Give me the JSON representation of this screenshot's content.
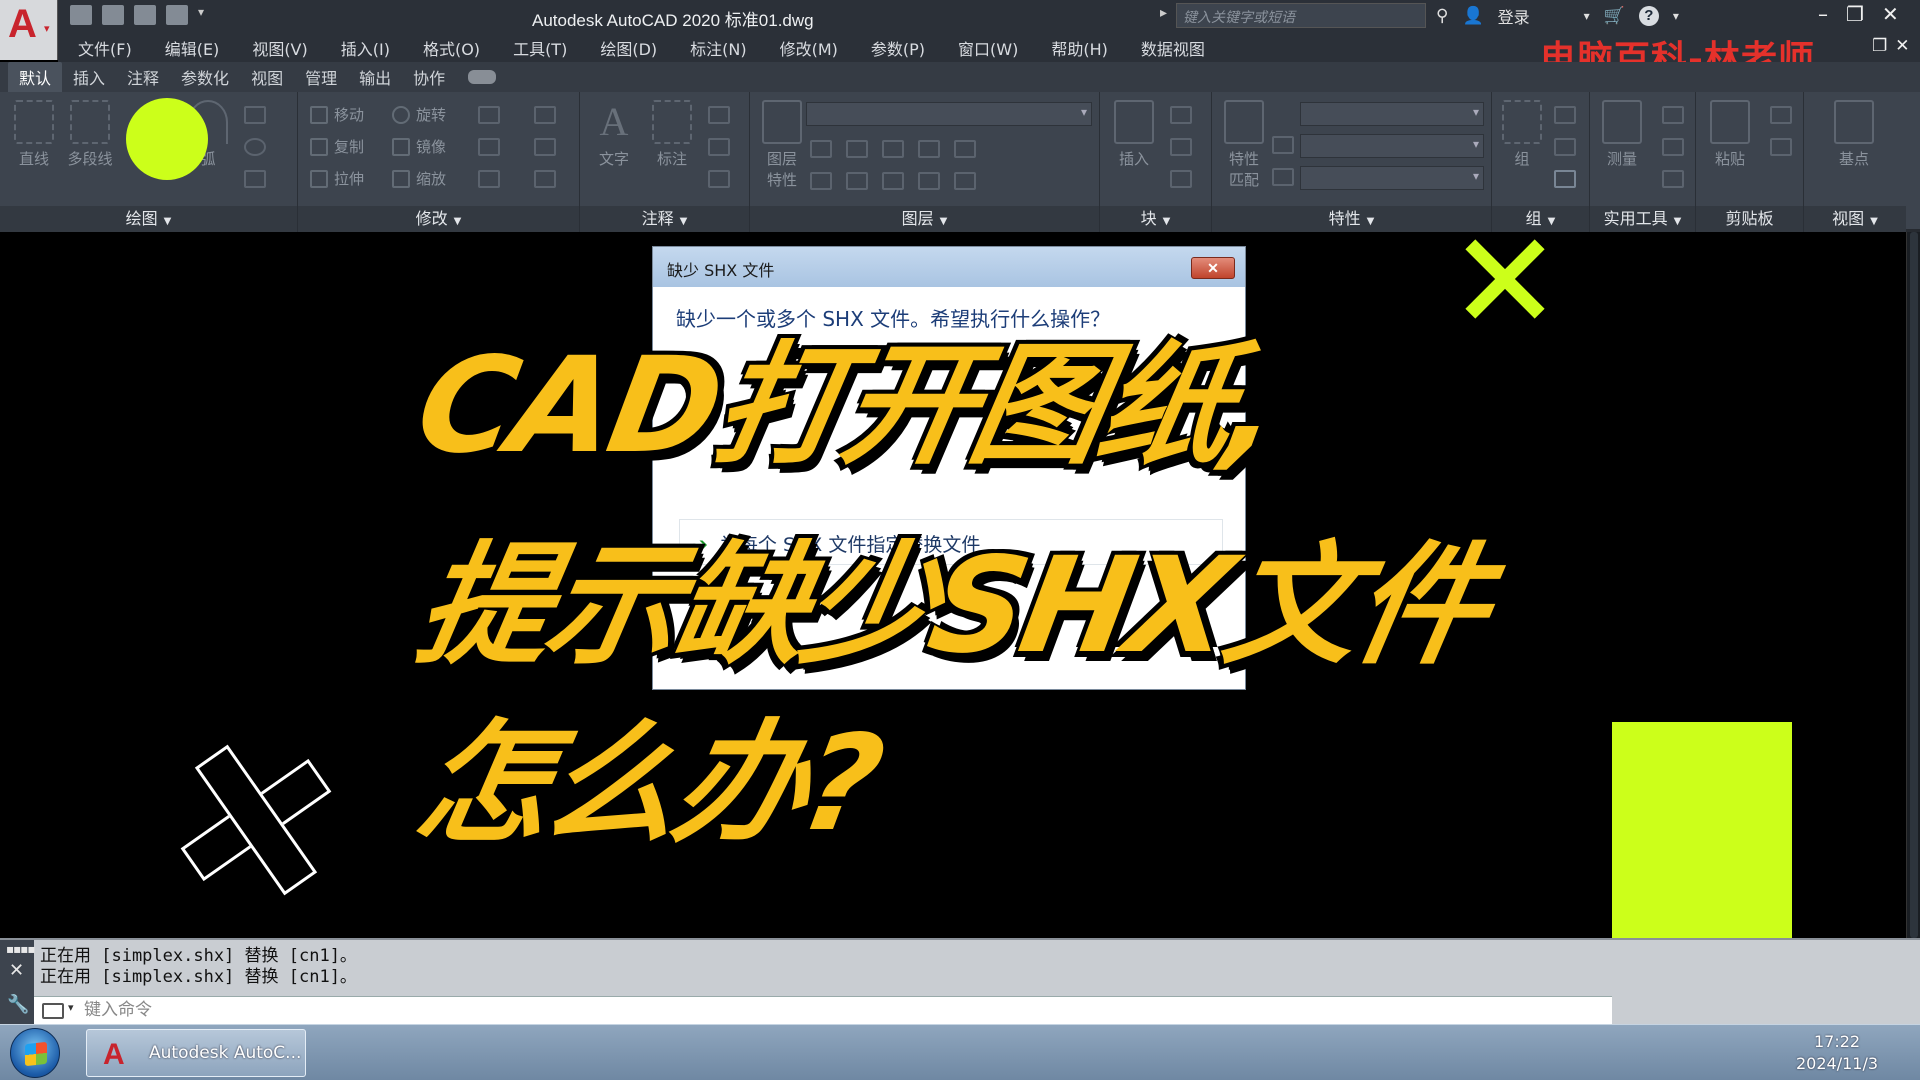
{
  "window": {
    "title": "Autodesk AutoCAD 2020    标准01.dwg",
    "search_placeholder": "键入关键字或短语",
    "login_label": "登录",
    "watermark": "电脑百科-林老师"
  },
  "menu": [
    "文件(F)",
    "编辑(E)",
    "视图(V)",
    "插入(I)",
    "格式(O)",
    "工具(T)",
    "绘图(D)",
    "标注(N)",
    "修改(M)",
    "参数(P)",
    "窗口(W)",
    "帮助(H)",
    "数据视图"
  ],
  "ribbon_tabs": [
    "默认",
    "插入",
    "注释",
    "参数化",
    "视图",
    "管理",
    "输出",
    "协作"
  ],
  "panels": {
    "draw": {
      "title": "绘图",
      "line": "直线",
      "polyline": "多段线",
      "arc": "弧"
    },
    "modify": {
      "title": "修改",
      "move": "移动",
      "rotate": "旋转",
      "copy": "复制",
      "mirror": "镜像",
      "stretch": "拉伸",
      "scale": "缩放"
    },
    "annotation": {
      "title": "注释",
      "text": "文字",
      "dimension": "标注"
    },
    "layers": {
      "title": "图层",
      "layer_props_1": "图层",
      "layer_props_2": "特性"
    },
    "block": {
      "title": "块",
      "insert": "插入"
    },
    "properties": {
      "title": "特性",
      "match_1": "特性",
      "match_2": "匹配"
    },
    "groups": {
      "title": "组",
      "group": "组"
    },
    "utilities": {
      "title": "实用工具",
      "measure": "测量"
    },
    "clipboard": {
      "title": "剪贴板",
      "paste": "粘贴"
    },
    "view": {
      "title": "视图",
      "base": "基点"
    }
  },
  "dialog": {
    "title": "缺少 SHX 文件",
    "close_label": "✕",
    "question": "缺少一个或多个 SHX 文件。希望执行什么操作？",
    "option": "为每个 SHX 文件指定替换文件"
  },
  "overlay": {
    "line1": "CAD打开图纸,",
    "line2": "提示缺少SHX文件",
    "line3": "怎么办?"
  },
  "command_line": {
    "history": [
      "正在用 [simplex.shx] 替换 [cn1]。",
      "正在用 [simplex.shx] 替换 [cn1]。"
    ],
    "placeholder": "键入命令"
  },
  "taskbar": {
    "app_label": "Autodesk AutoC...",
    "time": "17:22",
    "date": "2024/11/3"
  },
  "colors": {
    "overlay_text": "#f8bf1a",
    "accent_lime": "#ccff1a",
    "watermark_red": "#e5312b",
    "autocad_red": "#c8242d"
  }
}
